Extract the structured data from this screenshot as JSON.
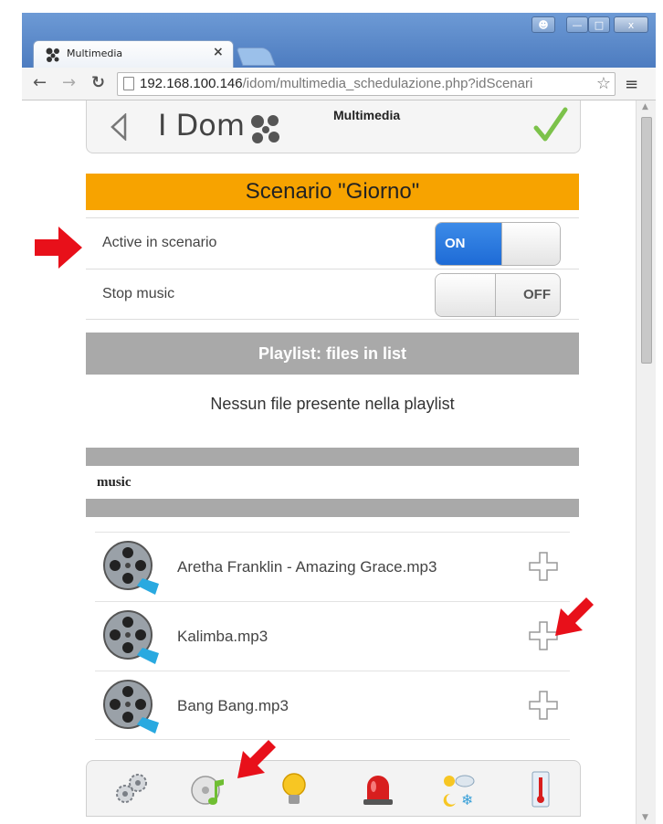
{
  "browser": {
    "tab_title": "Multimedia",
    "tab_close": "×",
    "url_host": "192.168.100.146",
    "url_path": "/idom/multimedia_schedulazione.php?idScenari",
    "window_controls": [
      "person-icon",
      "minimize-icon",
      "maximize-icon",
      "close-icon"
    ]
  },
  "header": {
    "logo_text": "I Dom",
    "section_title": "Multimedia"
  },
  "scenario": {
    "title": "Scenario \"Giorno\""
  },
  "settings": [
    {
      "label": "Active in scenario",
      "state": "ON"
    },
    {
      "label": "Stop music",
      "state": "OFF"
    }
  ],
  "playlist": {
    "header": "Playlist: files in list",
    "empty_message": "Nessun file presente nella playlist"
  },
  "library": {
    "folder": "music",
    "files": [
      {
        "name": "Aretha Franklin - Amazing Grace.mp3"
      },
      {
        "name": "Kalimba.mp3"
      },
      {
        "name": "Bang Bang.mp3"
      }
    ]
  },
  "bottom_nav": [
    "settings-gears-icon",
    "multimedia-icon",
    "lights-bulb-icon",
    "alarm-siren-icon",
    "weather-icon",
    "thermometer-icon"
  ],
  "colors": {
    "accent": "#f7a300",
    "toggle_on": "#1e6bd6",
    "section_gray": "#a9a9a9",
    "annotation_arrow": "#e8101a"
  }
}
